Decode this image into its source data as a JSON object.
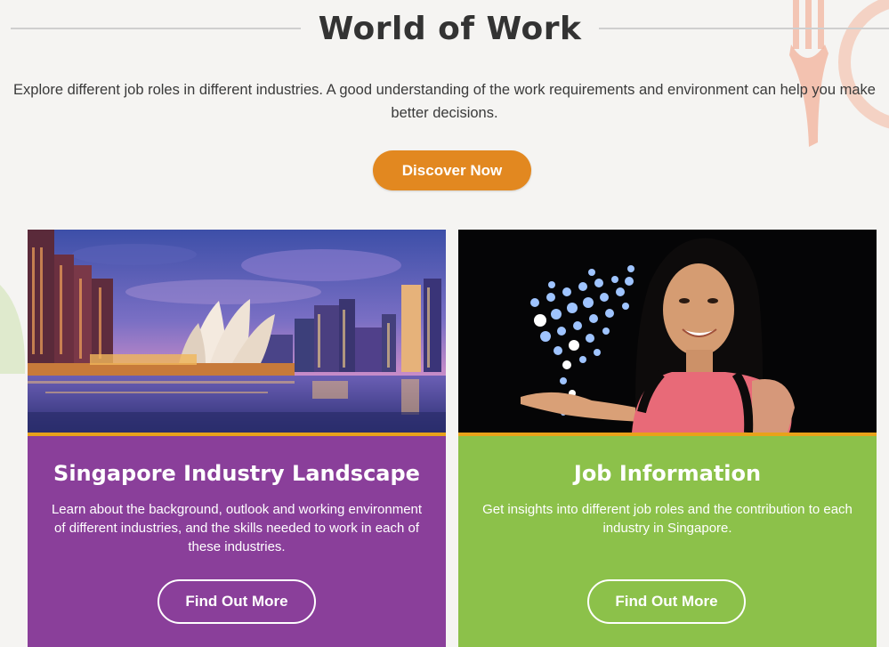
{
  "page": {
    "title": "World of Work",
    "intro_line1": "Explore different job roles in different industries. A good understanding of the work requirements and environment can help you make",
    "intro_line2": "better decisions.",
    "discover_label": "Discover Now"
  },
  "cards": [
    {
      "title": "Singapore Industry Landscape",
      "desc_lines": [
        "Learn about the background, outlook and working environment",
        "of different industries, and the skills needed to work in each of",
        "these industries."
      ],
      "button_label": "Find Out More"
    },
    {
      "title": "Job Information",
      "desc_lines": [
        "Get insights into different job roles and the contribution to each",
        "industry in Singapore."
      ],
      "button_label": "Find Out More"
    }
  ],
  "colors": {
    "accent_orange": "#e28820",
    "card_purple": "#8a3f9a",
    "card_green": "#8cc14a",
    "stripe": "#e8a21a"
  }
}
